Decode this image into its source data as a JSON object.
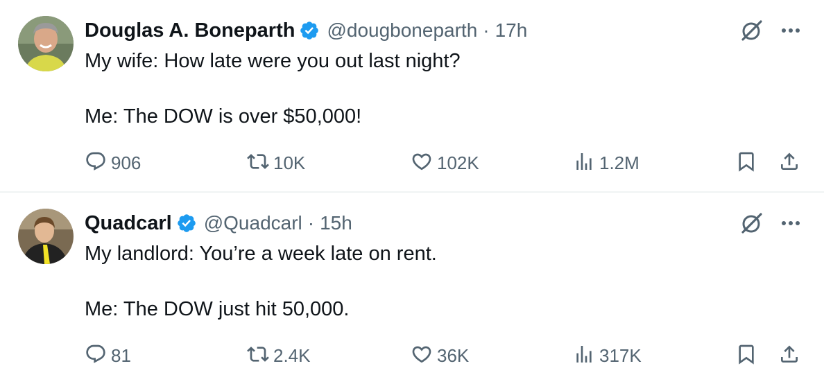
{
  "tweets": [
    {
      "author_name": "Douglas A. Boneparth",
      "handle": "@dougboneparth",
      "separator": "·",
      "time": "17h",
      "text_line1": "My wife: How late were you out last night?",
      "text_line2": "Me: The DOW is over $50,000!",
      "replies": "906",
      "retweets": "10K",
      "likes": "102K",
      "views": "1.2M"
    },
    {
      "author_name": "Quadcarl",
      "handle": "@Quadcarl",
      "separator": "·",
      "time": "15h",
      "text_line1": "My landlord: You’re a week late on rent.",
      "text_line2": "Me: The DOW just hit 50,000.",
      "replies": "81",
      "retweets": "2.4K",
      "likes": "36K",
      "views": "317K"
    }
  ],
  "icons": {
    "verified": "verified-badge-icon",
    "grok": "grok-icon",
    "more": "more-options-icon",
    "reply": "reply-icon",
    "retweet": "retweet-icon",
    "like": "heart-icon",
    "views": "analytics-icon",
    "bookmark": "bookmark-icon",
    "share": "share-icon"
  },
  "colors": {
    "text": "#0f1419",
    "secondary": "#536471",
    "verified": "#1d9bf0",
    "divider": "#eff3f4"
  }
}
